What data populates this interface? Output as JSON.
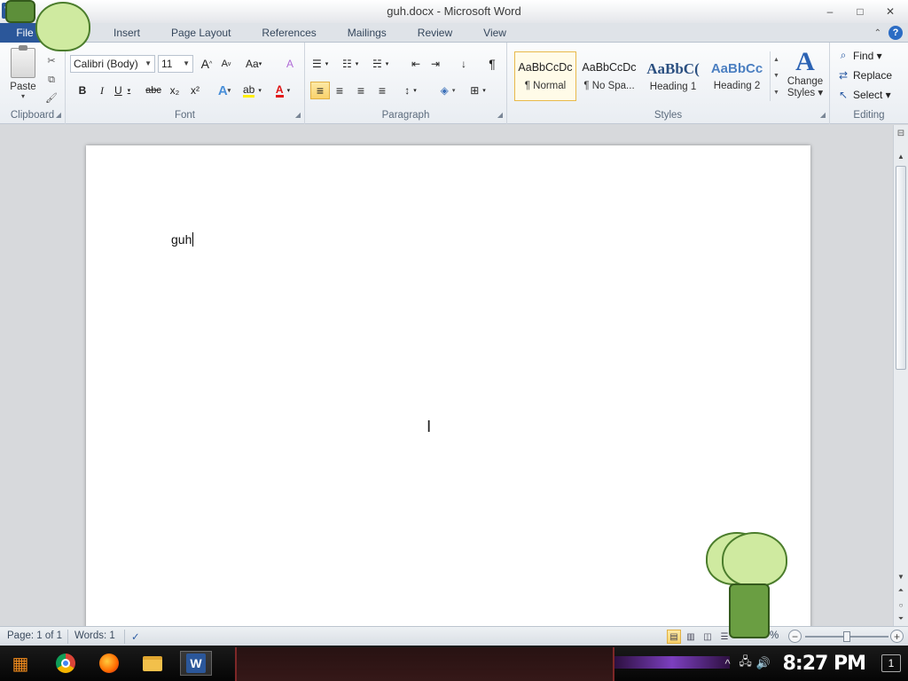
{
  "window": {
    "title": "guh.docx - Microsoft Word",
    "controls": {
      "minimize": "–",
      "maximize": "□",
      "close": "✕"
    }
  },
  "qat": {
    "logo": "W",
    "undo": "↶",
    "redo": "↺",
    "more": "▾"
  },
  "tabs": {
    "file": "File",
    "items": [
      "Insert",
      "Page Layout",
      "References",
      "Mailings",
      "Review",
      "View"
    ],
    "help": "?",
    "collapse": "⌃"
  },
  "clipboard": {
    "label": "Clipboard",
    "paste": "Paste",
    "paste_arrow": "▾",
    "cut": "✂",
    "copy": "⧉",
    "format_painter": "🖌"
  },
  "font": {
    "label": "Font",
    "family": "Calibri (Body)",
    "size": "11",
    "grow": "A",
    "shrink": "A",
    "change_case": "Aa",
    "clear": "A",
    "bold": "B",
    "italic": "I",
    "underline": "U",
    "strike": "abc",
    "subscript": "x₂",
    "superscript": "x²",
    "effects": "A",
    "highlight": "ab",
    "color": "A"
  },
  "paragraph": {
    "label": "Paragraph",
    "bullets": "☰",
    "numbering": "☷",
    "multilevel": "☵",
    "decrease_indent": "⇤",
    "increase_indent": "⇥",
    "sort": "↓",
    "pilcrow": "¶",
    "align_left": "≡",
    "center": "≡",
    "align_right": "≡",
    "justify": "≡",
    "line_spacing": "↕",
    "shading": "◈",
    "borders": "⊞"
  },
  "styles": {
    "label": "Styles",
    "items": [
      {
        "preview": "AaBbCcDc",
        "name": "¶ Normal"
      },
      {
        "preview": "AaBbCcDc",
        "name": "¶ No Spa..."
      },
      {
        "preview": "AaBbC(",
        "name": "Heading 1"
      },
      {
        "preview": "AaBbCc",
        "name": "Heading 2"
      }
    ],
    "change_styles_icon": "A",
    "change_styles_line1": "Change",
    "change_styles_line2": "Styles ▾"
  },
  "editing": {
    "label": "Editing",
    "find": "Find ▾",
    "replace": "Replace",
    "select": "Select ▾"
  },
  "document": {
    "text": "guh"
  },
  "status": {
    "page": "Page: 1 of 1",
    "words": "Words: 1",
    "zoom_minus": "−",
    "zoom_plus": "+",
    "zoom_pct": "%"
  },
  "taskbar": {
    "clock": "8:27 PM",
    "notifications": "1",
    "tray_up": "^"
  },
  "colors": {
    "accent": "#2b579a",
    "ribbon_bg": "#e9edf2",
    "doc_bg": "#d7d9dc"
  }
}
